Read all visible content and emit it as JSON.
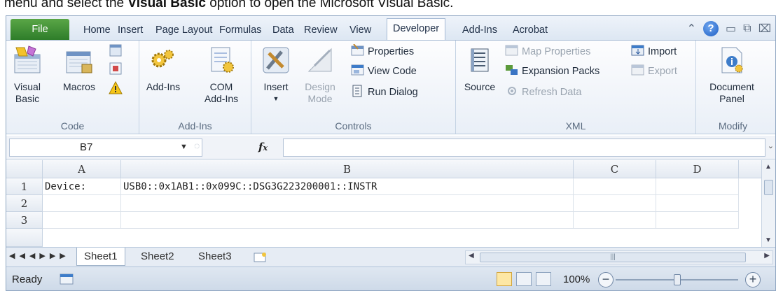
{
  "caption": {
    "pre": "menu and select the ",
    "bold": "Visual Basic",
    "post": " option to open the Microsoft Visual Basic."
  },
  "tabs": {
    "file": "File",
    "items": [
      "Home",
      "Insert",
      "Page Layout",
      "Formulas",
      "Data",
      "Review",
      "View",
      "Developer",
      "Add-Ins",
      "Acrobat"
    ],
    "active": "Developer"
  },
  "ribbon": {
    "code": {
      "label": "Code",
      "visual_basic_1": "Visual",
      "visual_basic_2": "Basic",
      "macros": "Macros"
    },
    "addins": {
      "label": "Add-Ins",
      "addins": "Add-Ins",
      "com_1": "COM",
      "com_2": "Add-Ins"
    },
    "controls": {
      "label": "Controls",
      "insert": "Insert",
      "design_1": "Design",
      "design_2": "Mode",
      "properties": "Properties",
      "view_code": "View Code",
      "run_dialog": "Run Dialog"
    },
    "xml": {
      "label": "XML",
      "source": "Source",
      "map_properties": "Map Properties",
      "expansion_packs": "Expansion Packs",
      "refresh_data": "Refresh Data",
      "import": "Import",
      "export": "Export"
    },
    "modify": {
      "label": "Modify",
      "doc_panel_1": "Document",
      "doc_panel_2": "Panel"
    }
  },
  "formula_bar": {
    "name_box": "B7",
    "fx": "fx",
    "value": ""
  },
  "columns": [
    "A",
    "B",
    "C",
    "D"
  ],
  "rows": [
    {
      "num": "1",
      "a": "Device:",
      "b": "USB0::0x1AB1::0x099C::DSG3G223200001::INSTR"
    },
    {
      "num": "2",
      "a": "",
      "b": ""
    },
    {
      "num": "3",
      "a": "",
      "b": ""
    }
  ],
  "sheets": [
    "Sheet1",
    "Sheet2",
    "Sheet3"
  ],
  "active_sheet": "Sheet1",
  "status": {
    "text": "Ready",
    "zoom": "100%",
    "zoom_level": 100
  },
  "colors": {
    "file_tab": "#3f8f34",
    "ribbon_bg": "#eef3fa",
    "accent": "#1f5fc4"
  }
}
